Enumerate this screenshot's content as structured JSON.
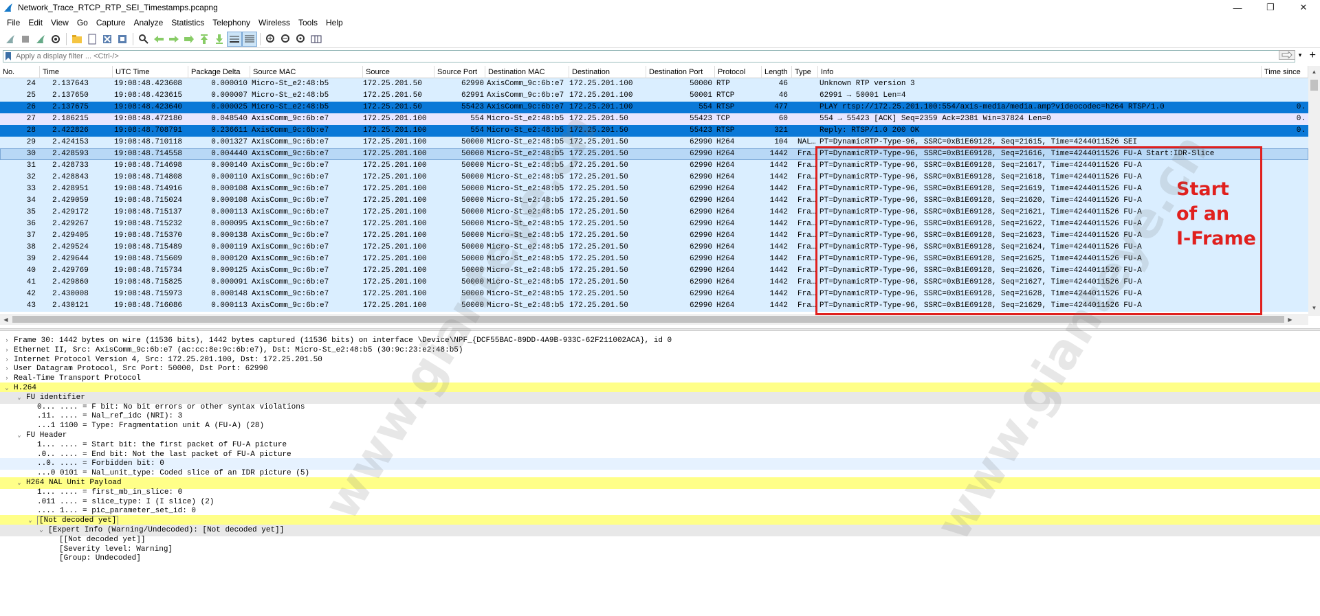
{
  "window": {
    "title": "Network_Trace_RTCP_RTP_SEI_Timestamps.pcapng",
    "minimize": "—",
    "maximize": "❐",
    "close": "✕"
  },
  "menu": [
    "File",
    "Edit",
    "View",
    "Go",
    "Capture",
    "Analyze",
    "Statistics",
    "Telephony",
    "Wireless",
    "Tools",
    "Help"
  ],
  "filter": {
    "placeholder": "Apply a display filter ... <Ctrl-/>",
    "apply_icon": "arrow-right-icon",
    "plus": "+"
  },
  "columns": [
    "No.",
    "Time",
    "UTC Time",
    "Package Delta",
    "Source MAC",
    "Source",
    "Source Port",
    "Destination MAC",
    "Destination",
    "Destination Port",
    "Protocol",
    "Length",
    "Type",
    "Info",
    "Time since"
  ],
  "packets": [
    {
      "no": "24",
      "time": "2.137643",
      "utc": "19:08:48.423608",
      "delta": "0.000010",
      "smac": "Micro-St_e2:48:b5",
      "src": "172.25.201.50",
      "sport": "62990",
      "dmac": "AxisComm_9c:6b:e7",
      "dst": "172.25.201.100",
      "dport": "50000",
      "proto": "RTP",
      "len": "46",
      "type": "",
      "info": "Unknown RTP version 3",
      "since": "",
      "cls": "udp"
    },
    {
      "no": "25",
      "time": "2.137650",
      "utc": "19:08:48.423615",
      "delta": "0.000007",
      "smac": "Micro-St_e2:48:b5",
      "src": "172.25.201.50",
      "sport": "62991",
      "dmac": "AxisComm_9c:6b:e7",
      "dst": "172.25.201.100",
      "dport": "50001",
      "proto": "RTCP",
      "len": "46",
      "type": "",
      "info": "62991 → 50001 Len=4",
      "since": "",
      "cls": "udp"
    },
    {
      "no": "26",
      "time": "2.137675",
      "utc": "19:08:48.423640",
      "delta": "0.000025",
      "smac": "Micro-St_e2:48:b5",
      "src": "172.25.201.50",
      "sport": "55423",
      "dmac": "AxisComm_9c:6b:e7",
      "dst": "172.25.201.100",
      "dport": "554",
      "proto": "RTSP",
      "len": "477",
      "type": "",
      "info": "PLAY rtsp://172.25.201.100:554/axis-media/media.amp?videocodec=h264 RTSP/1.0",
      "since": "0.",
      "cls": "sel"
    },
    {
      "no": "27",
      "time": "2.186215",
      "utc": "19:08:48.472180",
      "delta": "0.048540",
      "smac": "AxisComm_9c:6b:e7",
      "src": "172.25.201.100",
      "sport": "554",
      "dmac": "Micro-St_e2:48:b5",
      "dst": "172.25.201.50",
      "dport": "55423",
      "proto": "TCP",
      "len": "60",
      "type": "",
      "info": "554 → 55423 [ACK] Seq=2359 Ack=2381 Win=37824 Len=0",
      "since": "0.",
      "cls": "tcp"
    },
    {
      "no": "28",
      "time": "2.422826",
      "utc": "19:08:48.708791",
      "delta": "0.236611",
      "smac": "AxisComm_9c:6b:e7",
      "src": "172.25.201.100",
      "sport": "554",
      "dmac": "Micro-St_e2:48:b5",
      "dst": "172.25.201.50",
      "dport": "55423",
      "proto": "RTSP",
      "len": "321",
      "type": "",
      "info": "Reply: RTSP/1.0 200 OK",
      "since": "0.",
      "cls": "sel"
    },
    {
      "no": "29",
      "time": "2.424153",
      "utc": "19:08:48.710118",
      "delta": "0.001327",
      "smac": "AxisComm_9c:6b:e7",
      "src": "172.25.201.100",
      "sport": "50000",
      "dmac": "Micro-St_e2:48:b5",
      "dst": "172.25.201.50",
      "dport": "62990",
      "proto": "H264",
      "len": "104",
      "type": "NAL…",
      "info": "PT=DynamicRTP-Type-96, SSRC=0xB1E69128, Seq=21615, Time=4244011526 SEI",
      "since": "",
      "cls": "udp"
    },
    {
      "no": "30",
      "time": "2.428593",
      "utc": "19:08:48.714558",
      "delta": "0.004440",
      "smac": "AxisComm_9c:6b:e7",
      "src": "172.25.201.100",
      "sport": "50000",
      "dmac": "Micro-St_e2:48:b5",
      "dst": "172.25.201.50",
      "dport": "62990",
      "proto": "H264",
      "len": "1442",
      "type": "Fra…",
      "info": "PT=DynamicRTP-Type-96, SSRC=0xB1E69128, Seq=21616, Time=4244011526 FU-A Start:IDR-Slice",
      "since": "",
      "cls": "cur"
    },
    {
      "no": "31",
      "time": "2.428733",
      "utc": "19:08:48.714698",
      "delta": "0.000140",
      "smac": "AxisComm_9c:6b:e7",
      "src": "172.25.201.100",
      "sport": "50000",
      "dmac": "Micro-St_e2:48:b5",
      "dst": "172.25.201.50",
      "dport": "62990",
      "proto": "H264",
      "len": "1442",
      "type": "Fra…",
      "info": "PT=DynamicRTP-Type-96, SSRC=0xB1E69128, Seq=21617, Time=4244011526 FU-A",
      "since": "",
      "cls": "udp"
    },
    {
      "no": "32",
      "time": "2.428843",
      "utc": "19:08:48.714808",
      "delta": "0.000110",
      "smac": "AxisComm_9c:6b:e7",
      "src": "172.25.201.100",
      "sport": "50000",
      "dmac": "Micro-St_e2:48:b5",
      "dst": "172.25.201.50",
      "dport": "62990",
      "proto": "H264",
      "len": "1442",
      "type": "Fra…",
      "info": "PT=DynamicRTP-Type-96, SSRC=0xB1E69128, Seq=21618, Time=4244011526 FU-A",
      "since": "",
      "cls": "udp"
    },
    {
      "no": "33",
      "time": "2.428951",
      "utc": "19:08:48.714916",
      "delta": "0.000108",
      "smac": "AxisComm_9c:6b:e7",
      "src": "172.25.201.100",
      "sport": "50000",
      "dmac": "Micro-St_e2:48:b5",
      "dst": "172.25.201.50",
      "dport": "62990",
      "proto": "H264",
      "len": "1442",
      "type": "Fra…",
      "info": "PT=DynamicRTP-Type-96, SSRC=0xB1E69128, Seq=21619, Time=4244011526 FU-A",
      "since": "",
      "cls": "udp"
    },
    {
      "no": "34",
      "time": "2.429059",
      "utc": "19:08:48.715024",
      "delta": "0.000108",
      "smac": "AxisComm_9c:6b:e7",
      "src": "172.25.201.100",
      "sport": "50000",
      "dmac": "Micro-St_e2:48:b5",
      "dst": "172.25.201.50",
      "dport": "62990",
      "proto": "H264",
      "len": "1442",
      "type": "Fra…",
      "info": "PT=DynamicRTP-Type-96, SSRC=0xB1E69128, Seq=21620, Time=4244011526 FU-A",
      "since": "",
      "cls": "udp"
    },
    {
      "no": "35",
      "time": "2.429172",
      "utc": "19:08:48.715137",
      "delta": "0.000113",
      "smac": "AxisComm_9c:6b:e7",
      "src": "172.25.201.100",
      "sport": "50000",
      "dmac": "Micro-St_e2:48:b5",
      "dst": "172.25.201.50",
      "dport": "62990",
      "proto": "H264",
      "len": "1442",
      "type": "Fra…",
      "info": "PT=DynamicRTP-Type-96, SSRC=0xB1E69128, Seq=21621, Time=4244011526 FU-A",
      "since": "",
      "cls": "udp"
    },
    {
      "no": "36",
      "time": "2.429267",
      "utc": "19:08:48.715232",
      "delta": "0.000095",
      "smac": "AxisComm_9c:6b:e7",
      "src": "172.25.201.100",
      "sport": "50000",
      "dmac": "Micro-St_e2:48:b5",
      "dst": "172.25.201.50",
      "dport": "62990",
      "proto": "H264",
      "len": "1442",
      "type": "Fra…",
      "info": "PT=DynamicRTP-Type-96, SSRC=0xB1E69128, Seq=21622, Time=4244011526 FU-A",
      "since": "",
      "cls": "udp"
    },
    {
      "no": "37",
      "time": "2.429405",
      "utc": "19:08:48.715370",
      "delta": "0.000138",
      "smac": "AxisComm_9c:6b:e7",
      "src": "172.25.201.100",
      "sport": "50000",
      "dmac": "Micro-St_e2:48:b5",
      "dst": "172.25.201.50",
      "dport": "62990",
      "proto": "H264",
      "len": "1442",
      "type": "Fra…",
      "info": "PT=DynamicRTP-Type-96, SSRC=0xB1E69128, Seq=21623, Time=4244011526 FU-A",
      "since": "",
      "cls": "udp"
    },
    {
      "no": "38",
      "time": "2.429524",
      "utc": "19:08:48.715489",
      "delta": "0.000119",
      "smac": "AxisComm_9c:6b:e7",
      "src": "172.25.201.100",
      "sport": "50000",
      "dmac": "Micro-St_e2:48:b5",
      "dst": "172.25.201.50",
      "dport": "62990",
      "proto": "H264",
      "len": "1442",
      "type": "Fra…",
      "info": "PT=DynamicRTP-Type-96, SSRC=0xB1E69128, Seq=21624, Time=4244011526 FU-A",
      "since": "",
      "cls": "udp"
    },
    {
      "no": "39",
      "time": "2.429644",
      "utc": "19:08:48.715609",
      "delta": "0.000120",
      "smac": "AxisComm_9c:6b:e7",
      "src": "172.25.201.100",
      "sport": "50000",
      "dmac": "Micro-St_e2:48:b5",
      "dst": "172.25.201.50",
      "dport": "62990",
      "proto": "H264",
      "len": "1442",
      "type": "Fra…",
      "info": "PT=DynamicRTP-Type-96, SSRC=0xB1E69128, Seq=21625, Time=4244011526 FU-A",
      "since": "",
      "cls": "udp"
    },
    {
      "no": "40",
      "time": "2.429769",
      "utc": "19:08:48.715734",
      "delta": "0.000125",
      "smac": "AxisComm_9c:6b:e7",
      "src": "172.25.201.100",
      "sport": "50000",
      "dmac": "Micro-St_e2:48:b5",
      "dst": "172.25.201.50",
      "dport": "62990",
      "proto": "H264",
      "len": "1442",
      "type": "Fra…",
      "info": "PT=DynamicRTP-Type-96, SSRC=0xB1E69128, Seq=21626, Time=4244011526 FU-A",
      "since": "",
      "cls": "udp"
    },
    {
      "no": "41",
      "time": "2.429860",
      "utc": "19:08:48.715825",
      "delta": "0.000091",
      "smac": "AxisComm_9c:6b:e7",
      "src": "172.25.201.100",
      "sport": "50000",
      "dmac": "Micro-St_e2:48:b5",
      "dst": "172.25.201.50",
      "dport": "62990",
      "proto": "H264",
      "len": "1442",
      "type": "Fra…",
      "info": "PT=DynamicRTP-Type-96, SSRC=0xB1E69128, Seq=21627, Time=4244011526 FU-A",
      "since": "",
      "cls": "udp"
    },
    {
      "no": "42",
      "time": "2.430008",
      "utc": "19:08:48.715973",
      "delta": "0.000148",
      "smac": "AxisComm_9c:6b:e7",
      "src": "172.25.201.100",
      "sport": "50000",
      "dmac": "Micro-St_e2:48:b5",
      "dst": "172.25.201.50",
      "dport": "62990",
      "proto": "H264",
      "len": "1442",
      "type": "Fra…",
      "info": "PT=DynamicRTP-Type-96, SSRC=0xB1E69128, Seq=21628, Time=4244011526 FU-A",
      "since": "",
      "cls": "udp"
    },
    {
      "no": "43",
      "time": "2.430121",
      "utc": "19:08:48.716086",
      "delta": "0.000113",
      "smac": "AxisComm_9c:6b:e7",
      "src": "172.25.201.100",
      "sport": "50000",
      "dmac": "Micro-St_e2:48:b5",
      "dst": "172.25.201.50",
      "dport": "62990",
      "proto": "H264",
      "len": "1442",
      "type": "Fra…",
      "info": "PT=DynamicRTP-Type-96, SSRC=0xB1E69128, Seq=21629, Time=4244011526 FU-A",
      "since": "",
      "cls": "udp"
    }
  ],
  "details": [
    {
      "level": 0,
      "arrow": "›",
      "text": "Frame 30: 1442 bytes on wire (11536 bits), 1442 bytes captured (11536 bits) on interface \\Device\\NPF_{DCF55BAC-89DD-4A9B-933C-62F211002ACA}, id 0",
      "style": ""
    },
    {
      "level": 0,
      "arrow": "›",
      "text": "Ethernet II, Src: AxisComm_9c:6b:e7 (ac:cc:8e:9c:6b:e7), Dst: Micro-St_e2:48:b5 (30:9c:23:e2:48:b5)",
      "style": ""
    },
    {
      "level": 0,
      "arrow": "›",
      "text": "Internet Protocol Version 4, Src: 172.25.201.100, Dst: 172.25.201.50",
      "style": ""
    },
    {
      "level": 0,
      "arrow": "›",
      "text": "User Datagram Protocol, Src Port: 50000, Dst Port: 62990",
      "style": ""
    },
    {
      "level": 0,
      "arrow": "›",
      "text": "Real-Time Transport Protocol",
      "style": ""
    },
    {
      "level": 0,
      "arrow": "⌄",
      "text": "H.264",
      "style": "hl"
    },
    {
      "level": 1,
      "arrow": "⌄",
      "text": "FU identifier",
      "style": "gray"
    },
    {
      "level": 2,
      "arrow": "",
      "text": "0... .... = F bit: No bit errors or other syntax violations",
      "style": ""
    },
    {
      "level": 2,
      "arrow": "",
      "text": ".11. .... = Nal_ref_idc (NRI): 3",
      "style": ""
    },
    {
      "level": 2,
      "arrow": "",
      "text": "...1 1100 = Type: Fragmentation unit A (FU-A) (28)",
      "style": ""
    },
    {
      "level": 1,
      "arrow": "⌄",
      "text": "FU Header",
      "style": ""
    },
    {
      "level": 2,
      "arrow": "",
      "text": "1... .... = Start bit: the first packet of FU-A picture",
      "style": ""
    },
    {
      "level": 2,
      "arrow": "",
      "text": ".0.. .... = End bit: Not the last packet of FU-A picture",
      "style": ""
    },
    {
      "level": 2,
      "arrow": "",
      "text": "..0. .... = Forbidden bit: 0",
      "style": "blue"
    },
    {
      "level": 2,
      "arrow": "",
      "text": "...0 0101 = Nal_unit_type: Coded slice of an IDR picture (5)",
      "style": ""
    },
    {
      "level": 1,
      "arrow": "⌄",
      "text": "H264 NAL Unit Payload",
      "style": "hl"
    },
    {
      "level": 2,
      "arrow": "",
      "text": "1... .... = first_mb_in_slice: 0",
      "style": ""
    },
    {
      "level": 2,
      "arrow": "",
      "text": ".011 .... = slice_type: I (I slice) (2)",
      "style": ""
    },
    {
      "level": 2,
      "arrow": "",
      "text": ".... 1... = pic_parameter_set_id: 0",
      "style": ""
    },
    {
      "level": 2,
      "arrow": "⌄",
      "text": "[Not decoded yet]",
      "style": "hlbox"
    },
    {
      "level": 3,
      "arrow": "⌄",
      "text": "[Expert Info (Warning/Undecoded): [Not decoded yet]]",
      "style": "gray"
    },
    {
      "level": 4,
      "arrow": "",
      "text": "[[Not decoded yet]]",
      "style": ""
    },
    {
      "level": 4,
      "arrow": "",
      "text": "[Severity level: Warning]",
      "style": ""
    },
    {
      "level": 4,
      "arrow": "",
      "text": "[Group: Undecoded]",
      "style": ""
    }
  ],
  "annotation": {
    "lines": [
      "Start",
      "of an",
      "I-Frame"
    ],
    "color": "#e0201e"
  },
  "watermark": "www.gianteye.cn",
  "colors": {
    "udp_row": "#daeeff",
    "tcp_row": "#e7e6ff",
    "selected_row": "#0a78d7",
    "highlight": "#ffff88"
  }
}
